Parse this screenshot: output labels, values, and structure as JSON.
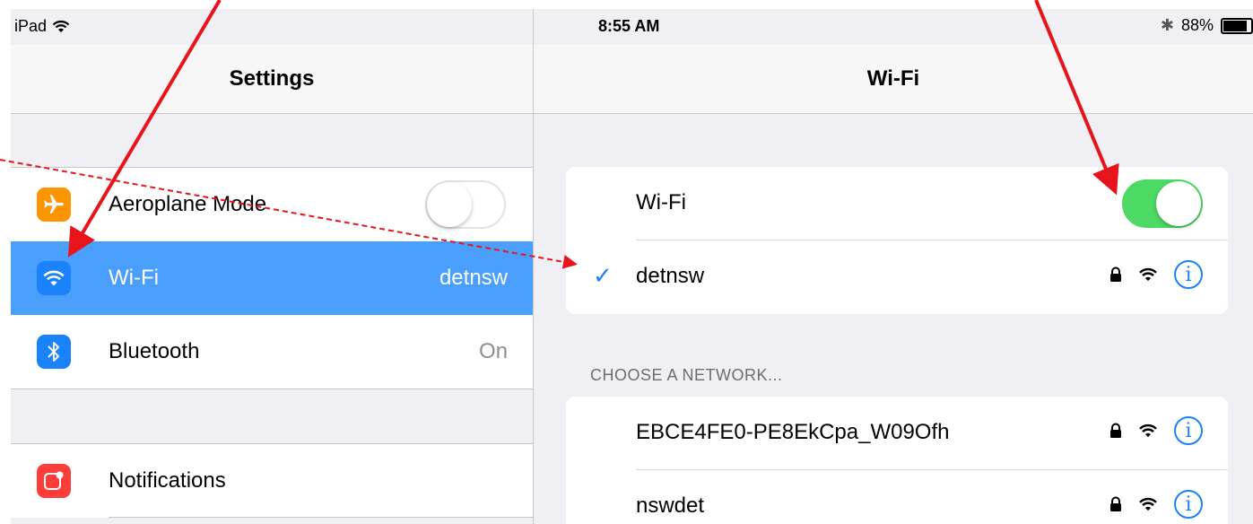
{
  "status_bar": {
    "device": "iPad",
    "time": "8:55 AM",
    "battery": "88%",
    "battery_level": 0.88
  },
  "left_panel": {
    "title": "Settings",
    "items": [
      {
        "label": "Aeroplane Mode",
        "icon": "airplane-icon",
        "color": "#fe9500",
        "toggle": "off"
      },
      {
        "label": "Wi-Fi",
        "icon": "wifi-icon",
        "color": "#1a82fb",
        "value": "detnsw",
        "selected": true
      },
      {
        "label": "Bluetooth",
        "icon": "bluetooth-icon",
        "color": "#1a82fb",
        "value": "On"
      },
      {
        "label": "Notifications",
        "icon": "notifications-icon",
        "color": "#fc3d39"
      }
    ]
  },
  "right_panel": {
    "title": "Wi-Fi",
    "wifi_toggle": {
      "label": "Wi-Fi",
      "state": "on"
    },
    "connected_network": "detnsw",
    "section_header": "CHOOSE A NETWORK...",
    "networks": [
      {
        "name": "EBCE4FE0-PE8EkCpa_W09Ofh"
      },
      {
        "name": "nswdet"
      }
    ]
  },
  "colors": {
    "selected": "#4a9ffc",
    "toggle_on": "#4cd964",
    "ios_blue": "#1a82fb",
    "annotation": "#e8141b"
  }
}
